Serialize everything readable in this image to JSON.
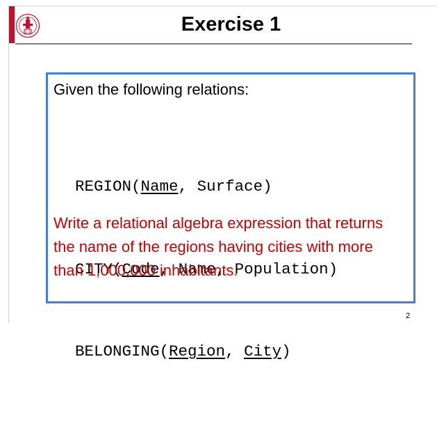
{
  "slide": {
    "title": "Exercise 1",
    "page_number": "2"
  },
  "exercise": {
    "intro": "Given the following relations:",
    "relations": [
      {
        "name": "REGION",
        "attributes": [
          {
            "text": "Name",
            "key": true
          },
          {
            "text": "Surface",
            "key": false
          }
        ]
      },
      {
        "name": "CITY",
        "attributes": [
          {
            "text": "Code",
            "key": true
          },
          {
            "text": "Name",
            "key": false
          },
          {
            "text": "Population",
            "key": false
          }
        ]
      },
      {
        "name": "BELONGING",
        "attributes": [
          {
            "text": "Region",
            "key": true
          },
          {
            "text": "City",
            "key": true
          }
        ]
      }
    ],
    "question": "Write a relational algebra expression that returns the name of the regions having cities with more than 1,000,000 inhabitants."
  },
  "colors": {
    "box_border": "#3f7fe6",
    "question_text": "#cc0000",
    "brand_red": "#c8102e"
  },
  "icons": {
    "logo": "university-seal-icon"
  }
}
